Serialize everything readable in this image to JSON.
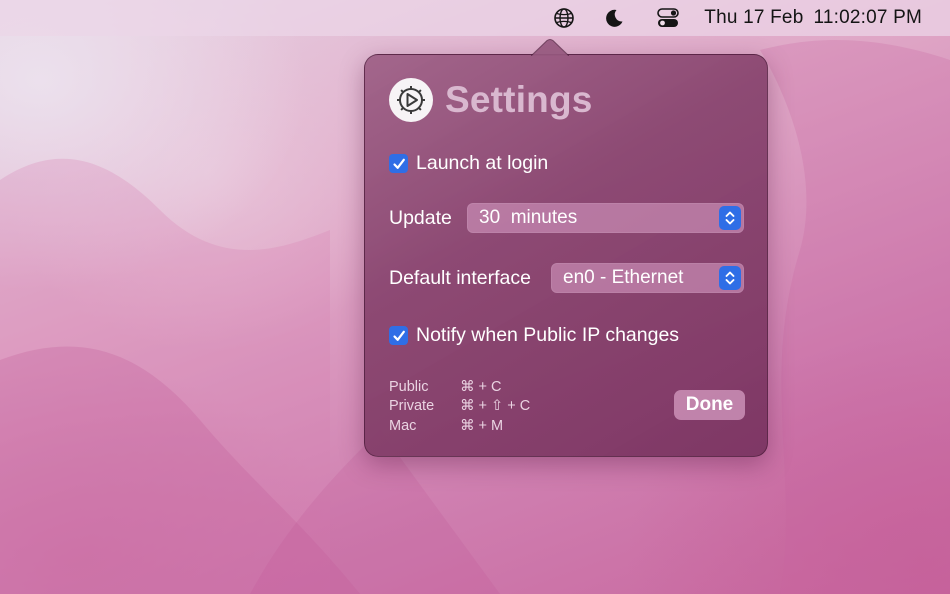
{
  "menubar": {
    "icons": [
      "globe-icon",
      "moon-icon",
      "control-center-icon"
    ],
    "date": "Thu 17 Feb",
    "time": "11:02:07 PM"
  },
  "settings": {
    "app_icon": "gear-play-icon",
    "title": "Settings",
    "launch_at_login": {
      "label": "Launch at login",
      "checked": true
    },
    "update": {
      "label": "Update",
      "value": "30  minutes"
    },
    "default_interface": {
      "label": "Default interface",
      "value": "en0 - Ethernet"
    },
    "notify": {
      "label": "Notify when Public IP changes",
      "checked": true
    },
    "shortcuts": [
      {
        "name": "Public",
        "keys": "⌘ + C"
      },
      {
        "name": "Private",
        "keys": "⌘ + ⇧ + C"
      },
      {
        "name": "Mac",
        "keys": "⌘ + M"
      }
    ],
    "done_label": "Done"
  },
  "colors": {
    "accent": "#2f6ee6",
    "popover": "#8a4a72",
    "title": "#d9b8cf"
  }
}
